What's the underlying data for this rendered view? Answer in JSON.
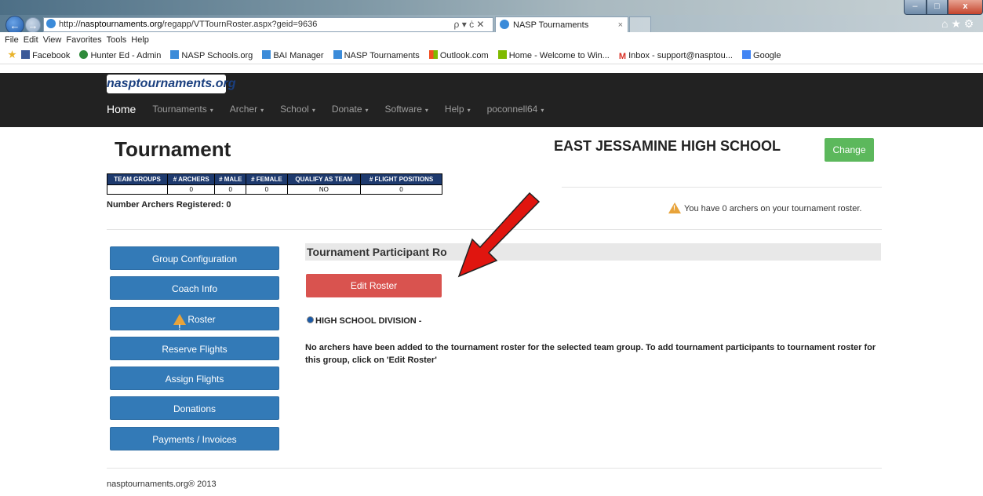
{
  "browser": {
    "url": "http://nasptournaments.org/regapp/VTTournRoster.aspx?geid=9636",
    "url_host": "nasptournaments.org",
    "url_path": "/regapp/VTTournRoster.aspx?geid=9636",
    "url_prefix": "http://",
    "address_controls": "ρ ▾ ċ ✕",
    "tab_title": "NASP Tournaments",
    "tab_close": "×",
    "menu": [
      "File",
      "Edit",
      "View",
      "Favorites",
      "Tools",
      "Help"
    ],
    "favorites": [
      "Facebook",
      "Hunter Ed - Admin",
      "NASP Schools.org",
      "BAI Manager",
      "NASP Tournaments",
      "Outlook.com",
      "Home - Welcome to Win...",
      "Inbox - support@nasptou...",
      "Google"
    ],
    "window_controls": {
      "minimize": "–",
      "maximize": "□",
      "close": "x"
    },
    "right_icons": "⌂ ★ ⚙"
  },
  "site_nav": {
    "brand": "nasptournaments.org",
    "items": [
      {
        "label": "Home",
        "caret": false
      },
      {
        "label": "Tournaments",
        "caret": true
      },
      {
        "label": "Archer",
        "caret": true
      },
      {
        "label": "School",
        "caret": true
      },
      {
        "label": "Donate",
        "caret": true
      },
      {
        "label": "Software",
        "caret": true
      },
      {
        "label": "Help",
        "caret": true
      },
      {
        "label": "poconnell64",
        "caret": true
      }
    ],
    "caret_glyph": "▾"
  },
  "page": {
    "title": "Tournament",
    "school_name": "EAST JESSAMINE HIGH SCHOOL",
    "change_label": "Change",
    "stats": {
      "headers": [
        "TEAM GROUPS",
        "# ARCHERS",
        "# MALE",
        "# FEMALE",
        "QUALIFY AS TEAM",
        "# FLIGHT POSITIONS"
      ],
      "row": [
        "",
        "0",
        "0",
        "0",
        "NO",
        "0"
      ]
    },
    "registered": "Number Archers Registered: 0",
    "roster_warning": "You have 0 archers on your tournament roster.",
    "side_menu": [
      "Group Configuration",
      "Coach Info",
      "Roster",
      "Reserve Flights",
      "Assign Flights",
      "Donations",
      "Payments / Invoices"
    ],
    "participant_header": "Tournament Participant Ro",
    "edit_roster_label": "Edit Roster",
    "division_label": "HIGH SCHOOL DIVISION -",
    "no_archers_message": "No archers have been added to the tournament roster for the selected team group. To add tournament participants to tournament roster for this group, click on 'Edit Roster'",
    "footer": "nasptournaments.org® 2013"
  },
  "colors": {
    "nav_bg": "#222222",
    "change_green": "#5cb85c",
    "side_blue": "#337ab7",
    "edit_red": "#d9534f",
    "table_header": "#1e3a6e",
    "arrow_red": "#e0150f"
  }
}
